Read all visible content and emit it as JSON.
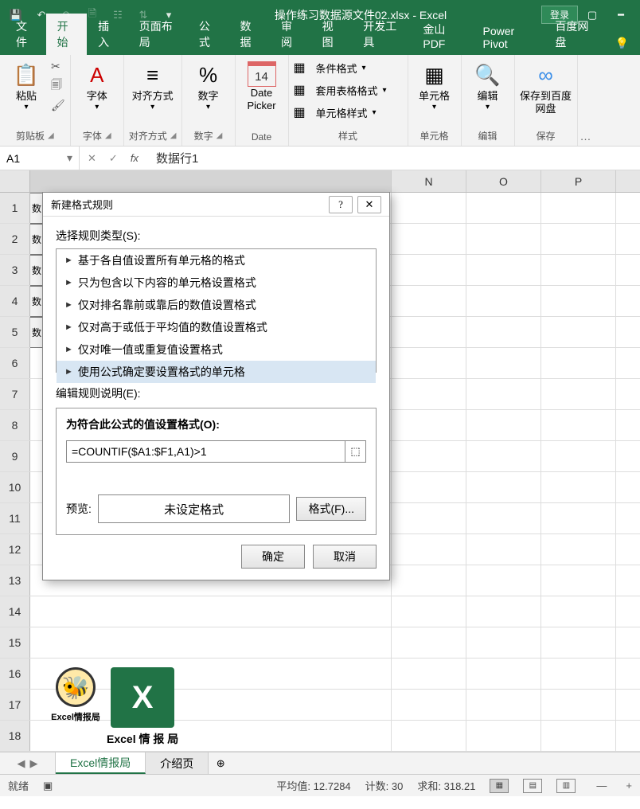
{
  "title": {
    "file": "操作练习数据源文件02.xlsx",
    "app": "Excel",
    "login": "登录"
  },
  "tabs": [
    "文件",
    "开始",
    "插入",
    "页面布局",
    "公式",
    "数据",
    "审阅",
    "视图",
    "开发工具",
    "金山PDF",
    "Power Pivot",
    "百度网盘"
  ],
  "active_tab": 1,
  "ribbon": {
    "clipboard": {
      "paste": "粘贴",
      "label": "剪贴板"
    },
    "font": {
      "btn": "字体",
      "label": "字体"
    },
    "align": {
      "btn": "对齐方式",
      "label": "对齐方式"
    },
    "number": {
      "btn": "数字",
      "label": "数字"
    },
    "date": {
      "btn": "Date Picker",
      "label": "Date",
      "num": "14"
    },
    "styles": {
      "cf": "条件格式",
      "tbl": "套用表格格式",
      "cell": "单元格样式",
      "label": "样式"
    },
    "cells": {
      "btn": "单元格",
      "label": "单元格"
    },
    "edit": {
      "btn": "编辑",
      "label": "编辑"
    },
    "save": {
      "btn": "保存到百度网盘",
      "label": "保存"
    }
  },
  "name_box": "A1",
  "formula_value": "数据行1",
  "columns_visible": [
    "N",
    "O",
    "P"
  ],
  "row_count": 18,
  "partial_cell": "数",
  "dialog": {
    "title": "新建格式规则",
    "select_label": "选择规则类型(S):",
    "rules": [
      "基于各自值设置所有单元格的格式",
      "只为包含以下内容的单元格设置格式",
      "仅对排名靠前或靠后的数值设置格式",
      "仅对高于或低于平均值的数值设置格式",
      "仅对唯一值或重复值设置格式",
      "使用公式确定要设置格式的单元格"
    ],
    "selected_rule": 5,
    "desc_label": "编辑规则说明(E):",
    "formula_label": "为符合此公式的值设置格式(O):",
    "formula_value": "=COUNTIF($A1:$F1,A1)>1",
    "preview_label": "预览:",
    "preview_text": "未设定格式",
    "format_btn": "格式(F)...",
    "ok": "确定",
    "cancel": "取消"
  },
  "logo": {
    "a": "Excel情报局",
    "b": "Excel 情 报 局"
  },
  "sheets": {
    "active": "Excel情报局",
    "other": "介绍页"
  },
  "status": {
    "ready": "就绪",
    "avg_label": "平均值:",
    "avg": "12.7284",
    "count_label": "计数:",
    "count": "30",
    "sum_label": "求和:",
    "sum": "318.21",
    "zoom": "+"
  }
}
